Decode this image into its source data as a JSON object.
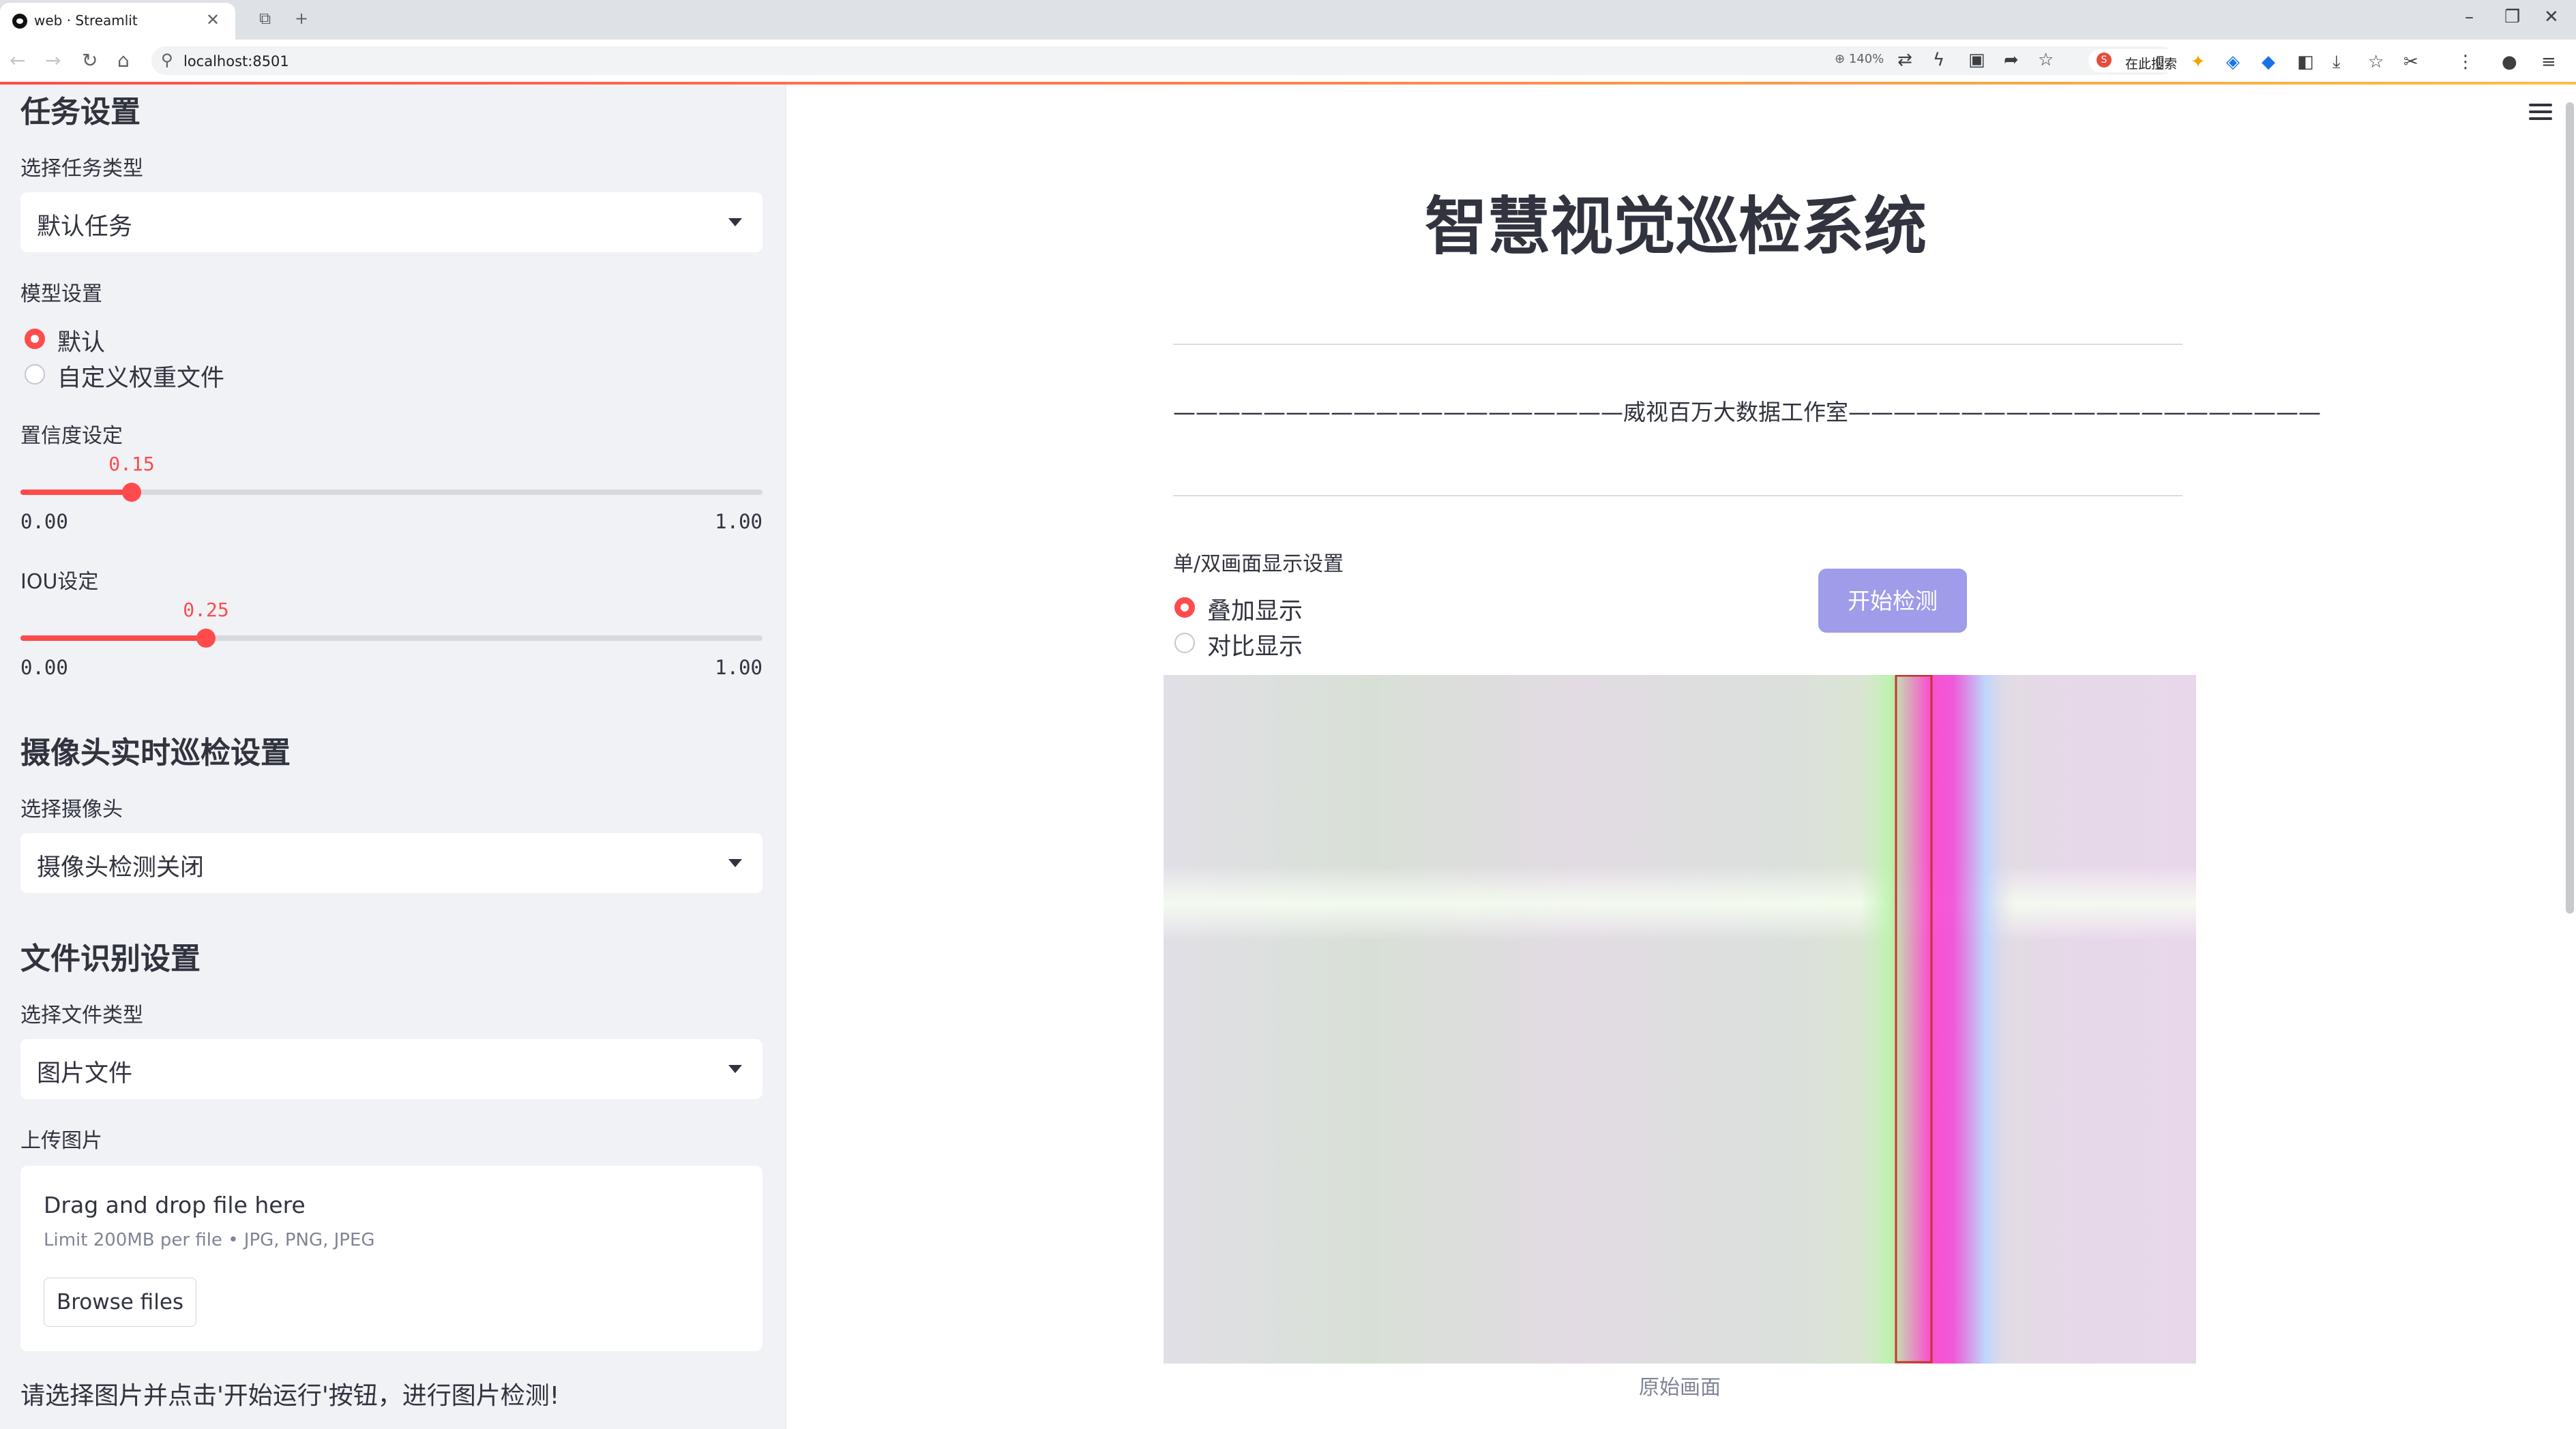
{
  "browser": {
    "tab_title": "web · Streamlit",
    "url": "localhost:8501",
    "zoom": "140%",
    "search_label": "在此搜索",
    "search_engine_letter": "S"
  },
  "sidebar": {
    "task_heading": "任务设置",
    "task_type_label": "选择任务类型",
    "task_type_value": "默认任务",
    "model_label": "模型设置",
    "model_options": [
      "默认",
      "自定义权重文件"
    ],
    "model_selected": 0,
    "confidence": {
      "label": "置信度设定",
      "value": 0.15,
      "value_text": "0.15",
      "min": "0.00",
      "max": "1.00"
    },
    "iou": {
      "label": "IOU设定",
      "value": 0.25,
      "value_text": "0.25",
      "min": "0.00",
      "max": "1.00"
    },
    "camera_heading": "摄像头实时巡检设置",
    "camera_label": "选择摄像头",
    "camera_value": "摄像头检测关闭",
    "file_heading": "文件识别设置",
    "file_type_label": "选择文件类型",
    "file_type_value": "图片文件",
    "upload_label": "上传图片",
    "uploader": {
      "title": "Drag and drop file here",
      "limit": "Limit 200MB per file • JPG, PNG, JPEG",
      "button": "Browse files"
    },
    "hint": "请选择图片并点击'开始运行'按钮，进行图片检测!"
  },
  "main": {
    "title": "智慧视觉巡检系统",
    "subtitle": "————————————————————威视百万大数据工作室—————————————————————",
    "display_label": "单/双画面显示设置",
    "display_options": [
      "叠加显示",
      "对比显示"
    ],
    "display_selected": 0,
    "start_button": "开始检测",
    "image_caption": "原始画面"
  },
  "colors": {
    "accent": "#ff4b4b",
    "button": "#9f9ce9",
    "sidebar_bg": "#f0f2f6",
    "detection_box": "#c0392b"
  }
}
